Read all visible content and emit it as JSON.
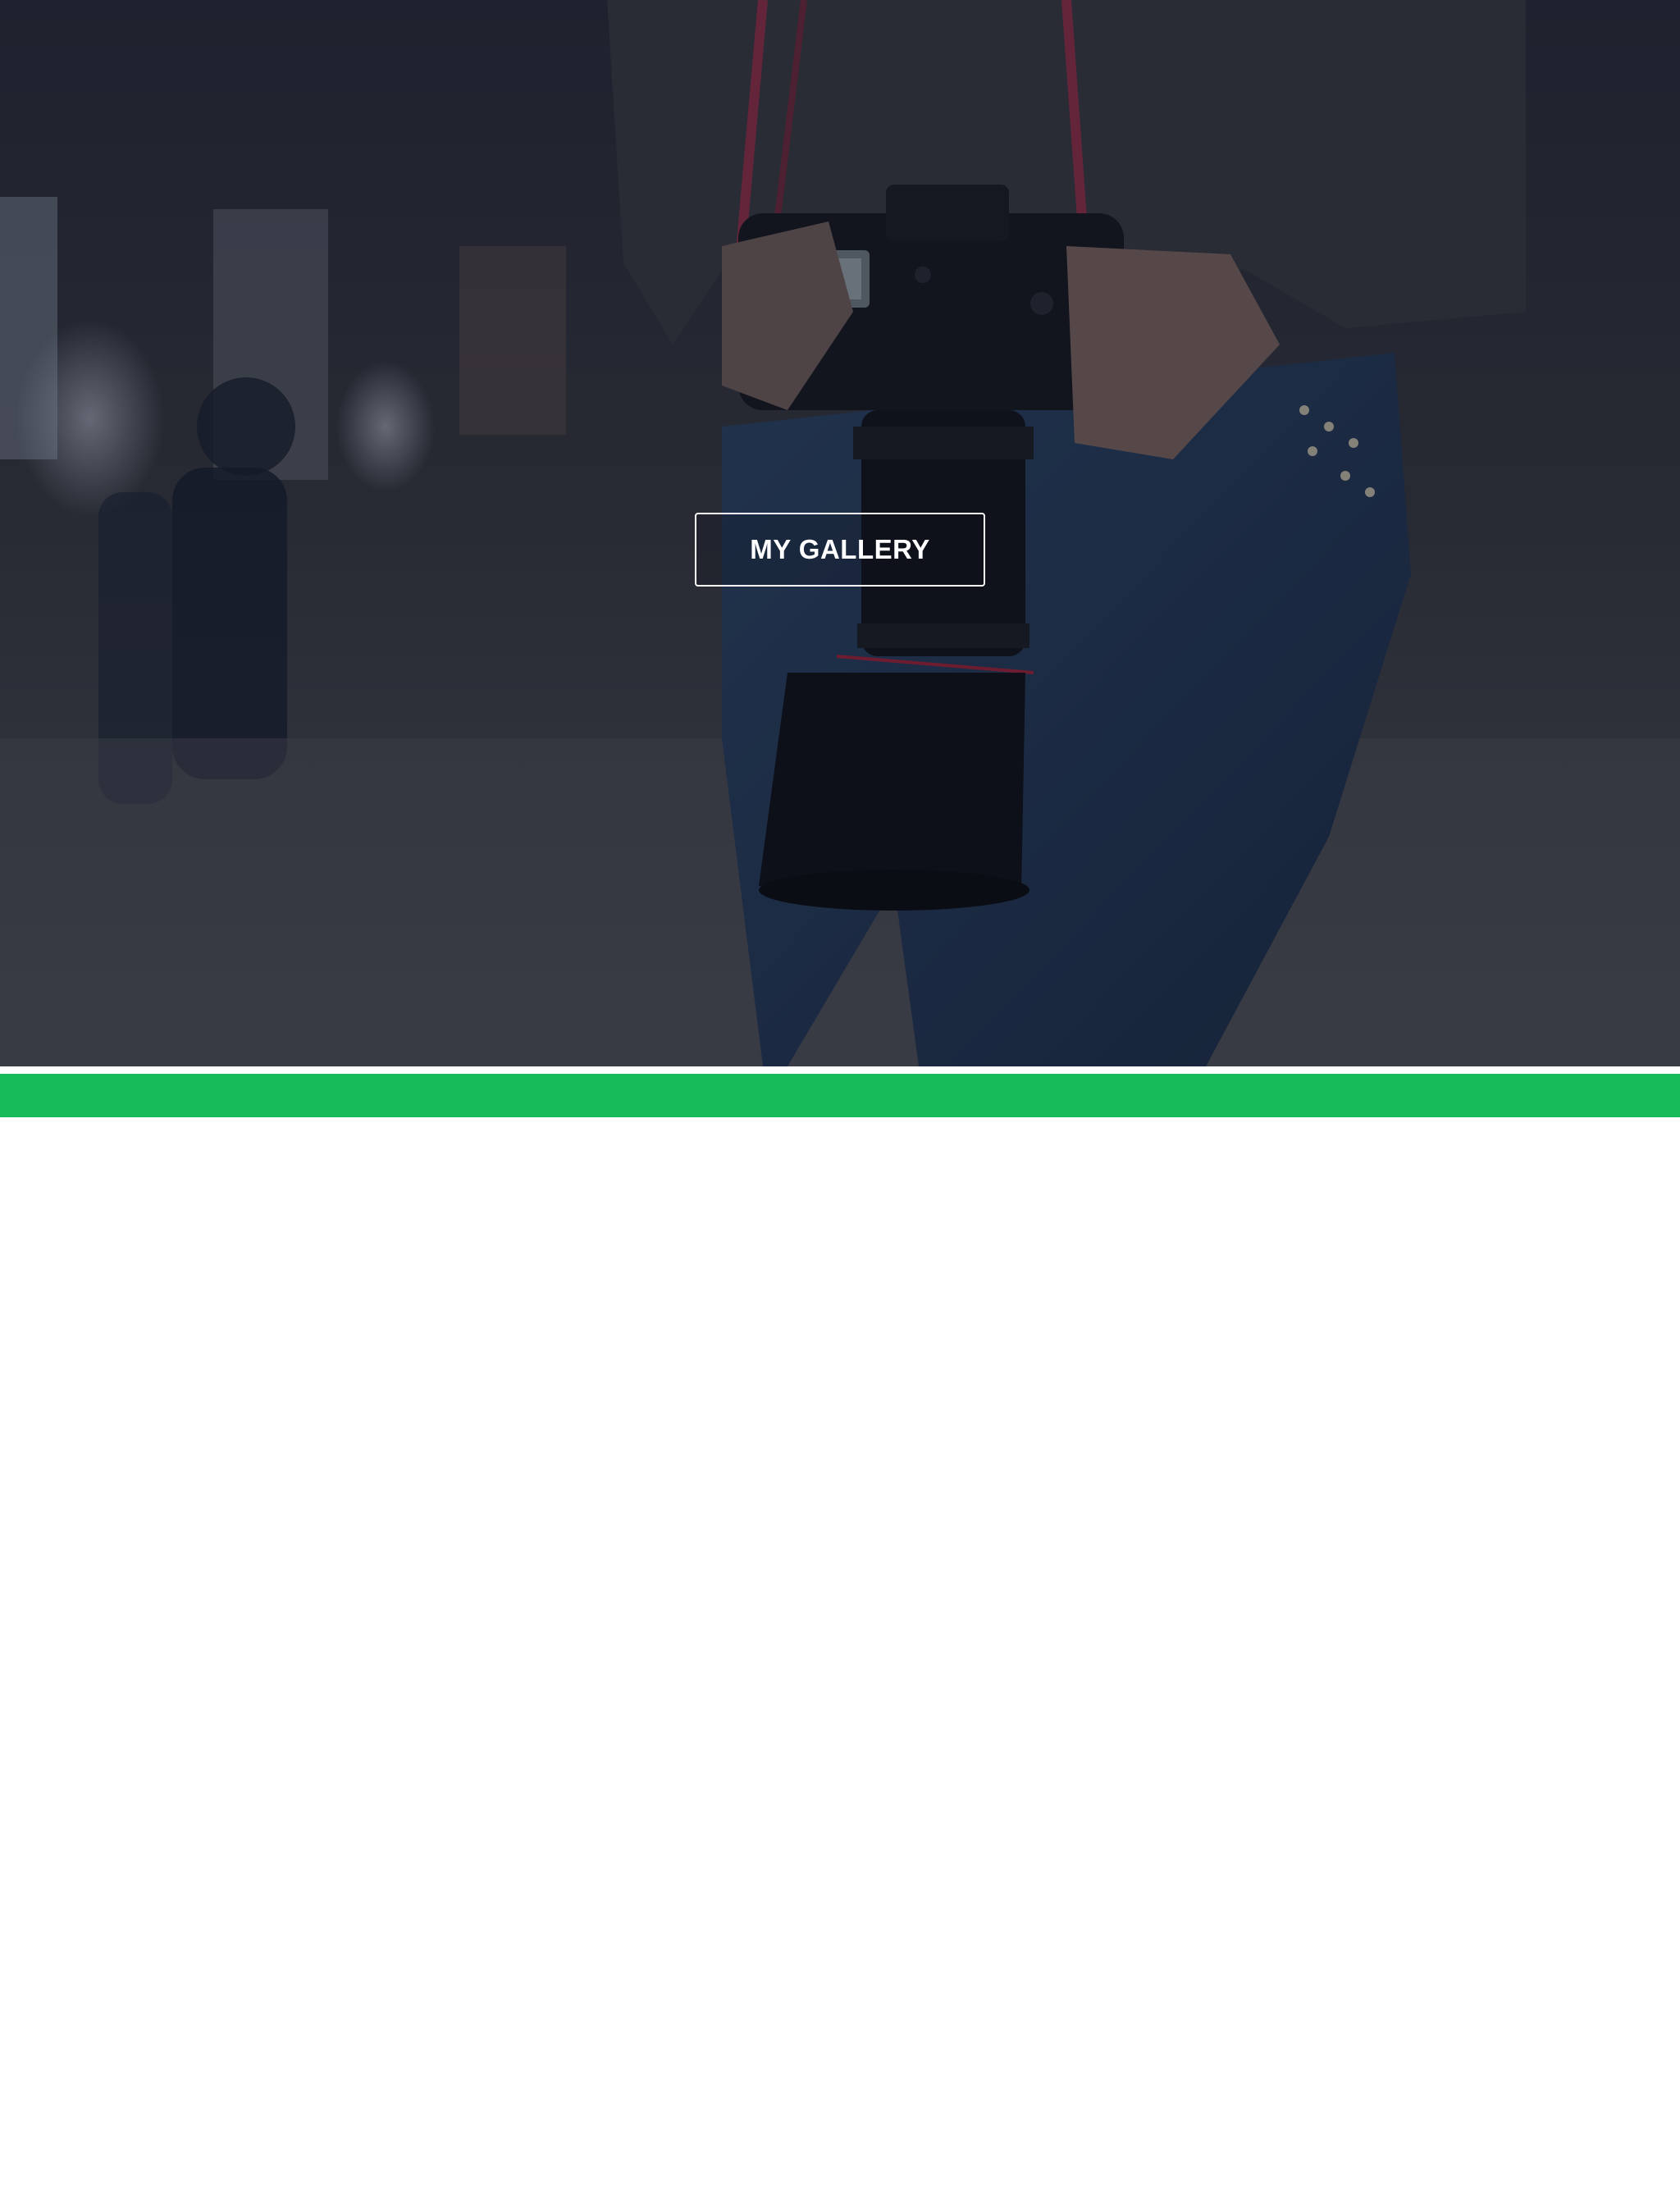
{
  "hero": {
    "image_icon": "photographer-with-camera-photo",
    "overlay_color": "#0e1422",
    "button_label": "MY GALLERY"
  },
  "nav_bar": {
    "color": "#18bb59",
    "active_tab_color": "#ffffff"
  }
}
